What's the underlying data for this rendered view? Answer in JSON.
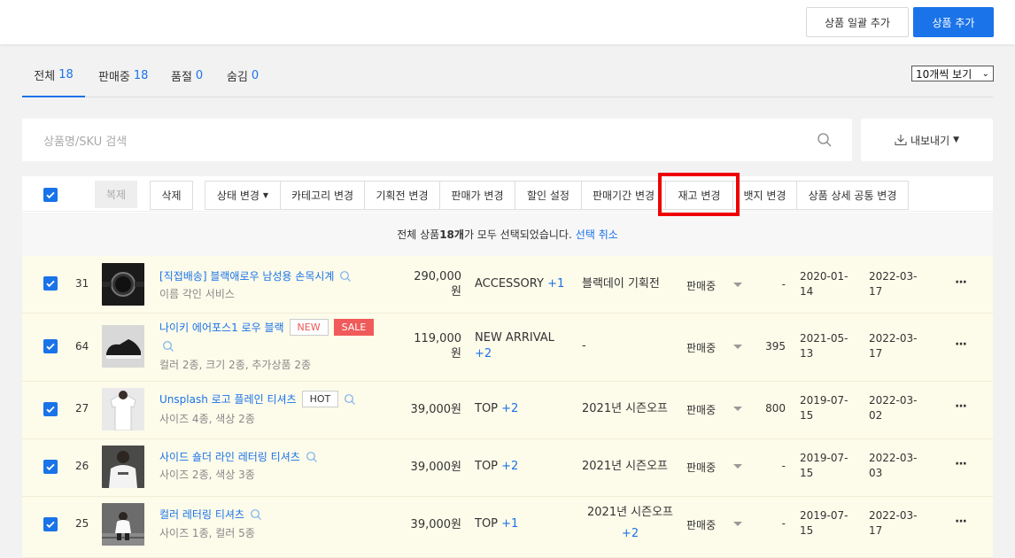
{
  "header": {
    "bulk_add_label": "상품 일괄 추가",
    "add_label": "상품 추가"
  },
  "tabs": [
    {
      "label": "전체",
      "count": "18"
    },
    {
      "label": "판매중",
      "count": "18"
    },
    {
      "label": "품절",
      "count": "0"
    },
    {
      "label": "숨김",
      "count": "0"
    }
  ],
  "page_size": "10개씩 보기",
  "search": {
    "placeholder": "상품명/SKU 검색"
  },
  "export_label": "내보내기",
  "toolbar": {
    "copy": "복제",
    "delete": "삭제",
    "status": "상태 변경",
    "category": "카테고리 변경",
    "promo": "기획전 변경",
    "price": "판매가 변경",
    "discount": "할인 설정",
    "period": "판매기간 변경",
    "stock": "재고 변경",
    "badge": "뱃지 변경",
    "detail": "상품 상세 공통 변경"
  },
  "notice": {
    "prefix": "전체 상품 ",
    "count": "18개",
    "suffix": "가 모두 선택되었습니다.",
    "link": "선택 취소"
  },
  "products": [
    {
      "num": "31",
      "name": "[직접배송] 블랙애로우 남성용 손목시계",
      "sub": "이름 각인 서비스",
      "badges": [],
      "price1": "290,000",
      "price2": "원",
      "cat": "ACCESSORY",
      "cat_plus": "+1",
      "plan": "블랙데이 기획전",
      "plan_plus": "",
      "status": "판매중",
      "stock": "-",
      "date1a": "2020-01-",
      "date1b": "14",
      "date2a": "2022-03-",
      "date2b": "17"
    },
    {
      "num": "64",
      "name": "나이키 에어포스1 로우 블랙",
      "sub": "컬러 2종, 크기 2종, 추가상품 2종",
      "badges": [
        "NEW",
        "SALE"
      ],
      "price1": "119,000",
      "price2": "원",
      "cat": "NEW ARRIVAL",
      "cat_plus": "+2",
      "plan": "-",
      "plan_plus": "",
      "status": "판매중",
      "stock": "395",
      "date1a": "2021-05-",
      "date1b": "13",
      "date2a": "2022-03-",
      "date2b": "17"
    },
    {
      "num": "27",
      "name": "Unsplash 로고 플레인 티셔츠",
      "sub": "사이즈 4종, 색상 2종",
      "badges": [
        "HOT"
      ],
      "price1": "39,000원",
      "price2": "",
      "cat": "TOP",
      "cat_plus": "+2",
      "plan": "2021년 시즌오프",
      "plan_plus": "",
      "status": "판매중",
      "stock": "800",
      "date1a": "2019-07-",
      "date1b": "15",
      "date2a": "2022-03-",
      "date2b": "02"
    },
    {
      "num": "26",
      "name": "사이드 숄더 라인 레터링 티셔츠",
      "sub": "사이즈 2종, 색상 3종",
      "badges": [],
      "price1": "39,000원",
      "price2": "",
      "cat": "TOP",
      "cat_plus": "+2",
      "plan": "2021년 시즌오프",
      "plan_plus": "",
      "status": "판매중",
      "stock": "-",
      "date1a": "2019-07-",
      "date1b": "15",
      "date2a": "2022-03-",
      "date2b": "03"
    },
    {
      "num": "25",
      "name": "컬러 레터링 티셔츠",
      "sub": "사이즈 1종, 컬러 5종",
      "badges": [],
      "price1": "39,000원",
      "price2": "",
      "cat": "TOP",
      "cat_plus": "+1",
      "plan": "2021년 시즌오프",
      "plan_plus": "+2",
      "status": "판매중",
      "stock": "-",
      "date1a": "2019-07-",
      "date1b": "15",
      "date2a": "2022-03-",
      "date2b": "17"
    }
  ]
}
